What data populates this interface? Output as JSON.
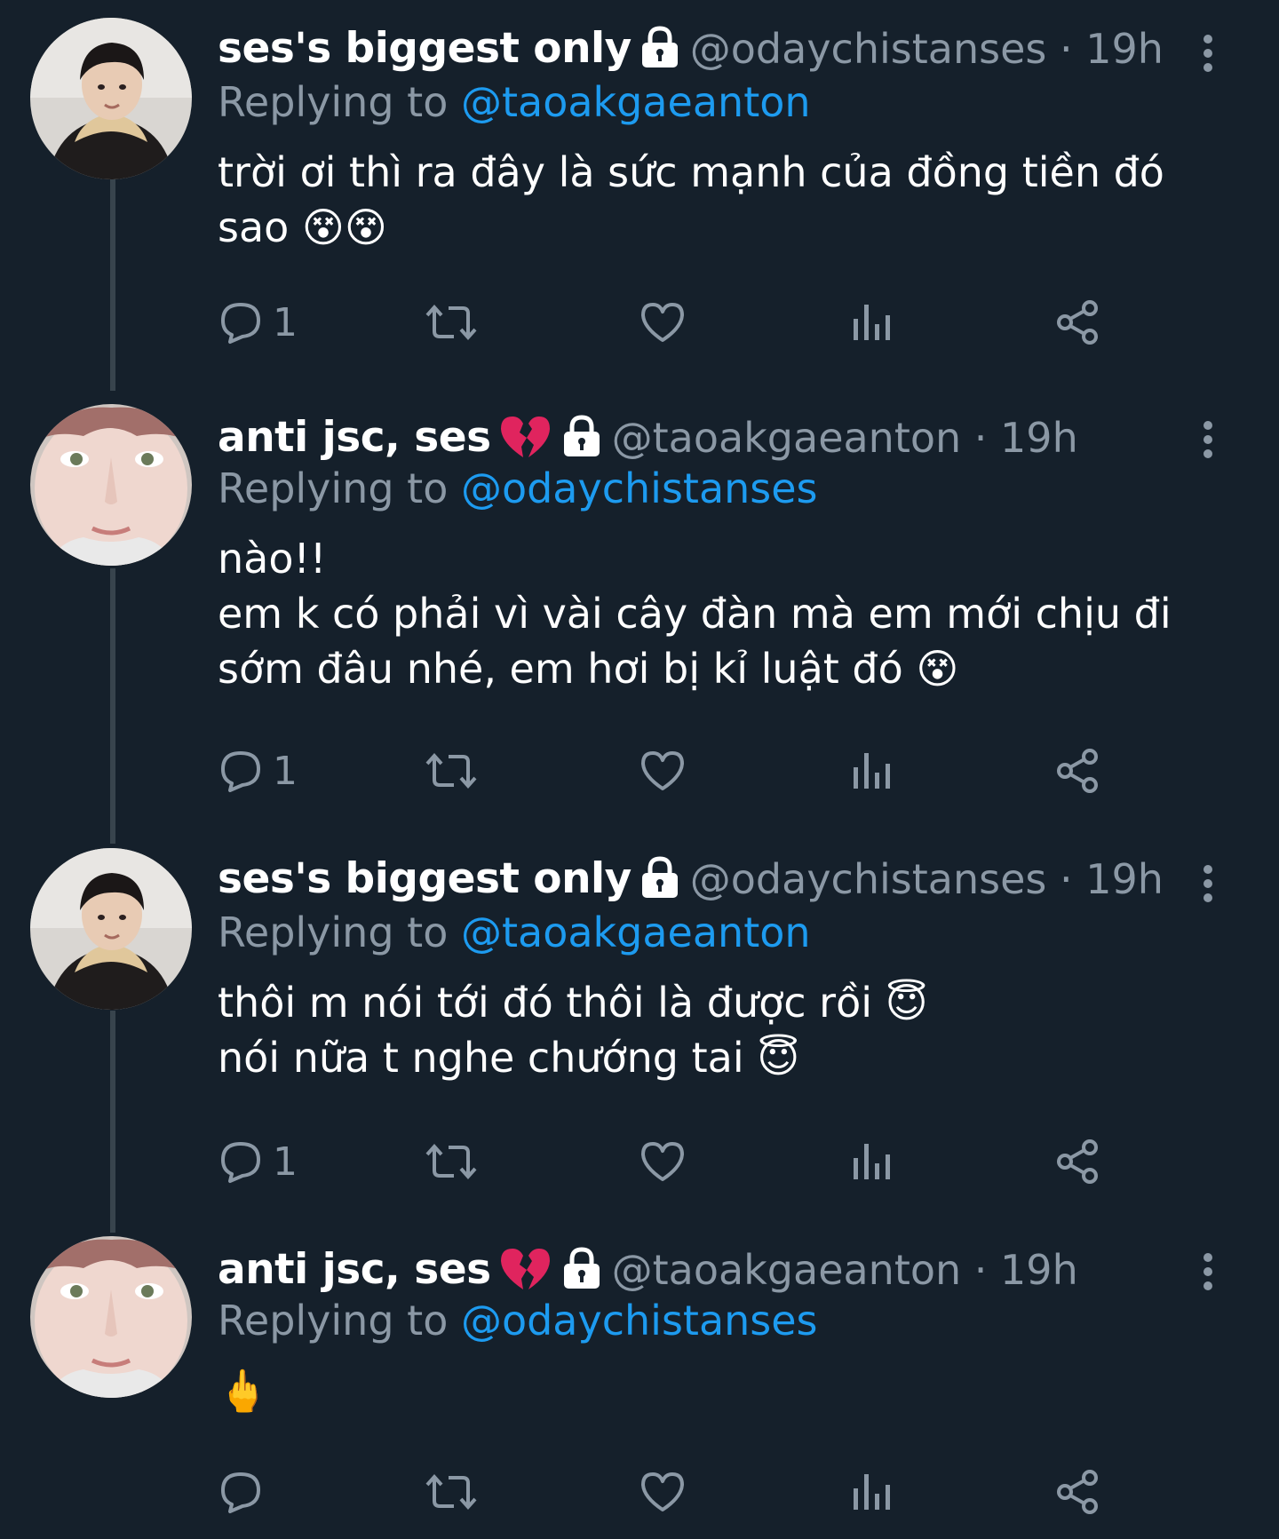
{
  "tweets": [
    {
      "display_name": "ses's biggest only",
      "handle_time": "@odaychistanses · 19h",
      "reply_prefix": "Replying to ",
      "reply_to": "@taoakgaeanton",
      "text": "trời ơi thì ra đây là sức mạnh của đồng tiền đó sao 😵😵",
      "reply_count": "1",
      "avatar": "boy-in-fur-collar-jacket",
      "badges": [
        "lock-icon"
      ]
    },
    {
      "display_name": "anti jsc, ses",
      "handle_time": "@taoakgaeanton · 19h",
      "reply_prefix": "Replying to ",
      "reply_to": "@odaychistanses",
      "text": "nào!!\nem k có phải vì vài cây đàn mà em mới chịu đi sớm đâu nhé, em hơi bị kỉ luật đó 😵",
      "reply_count": "1",
      "avatar": "close-up-face-selfie",
      "badges": [
        "broken-heart-icon",
        "lock-icon"
      ]
    },
    {
      "display_name": "ses's biggest only",
      "handle_time": "@odaychistanses · 19h",
      "reply_prefix": "Replying to ",
      "reply_to": "@taoakgaeanton",
      "text": "thôi m nói tới đó thôi là được rồi 😇\nnói nữa t nghe chướng tai 😇",
      "reply_count": "1",
      "avatar": "boy-in-fur-collar-jacket",
      "badges": [
        "lock-icon"
      ]
    },
    {
      "display_name": "anti jsc, ses",
      "handle_time": "@taoakgaeanton · 19h",
      "reply_prefix": "Replying to ",
      "reply_to": "@odaychistanses",
      "text": "🖕",
      "reply_count": "",
      "avatar": "close-up-face-selfie",
      "badges": [
        "broken-heart-icon",
        "lock-icon"
      ]
    }
  ],
  "action_icons": [
    "reply-icon",
    "retweet-icon",
    "like-icon",
    "views-icon",
    "share-icon"
  ],
  "colors": {
    "background": "#15202b",
    "text": "#ffffff",
    "secondary": "#8b98a5",
    "link": "#1d9bf0",
    "thread_line": "#38444d",
    "broken_heart": "#e0245e"
  }
}
